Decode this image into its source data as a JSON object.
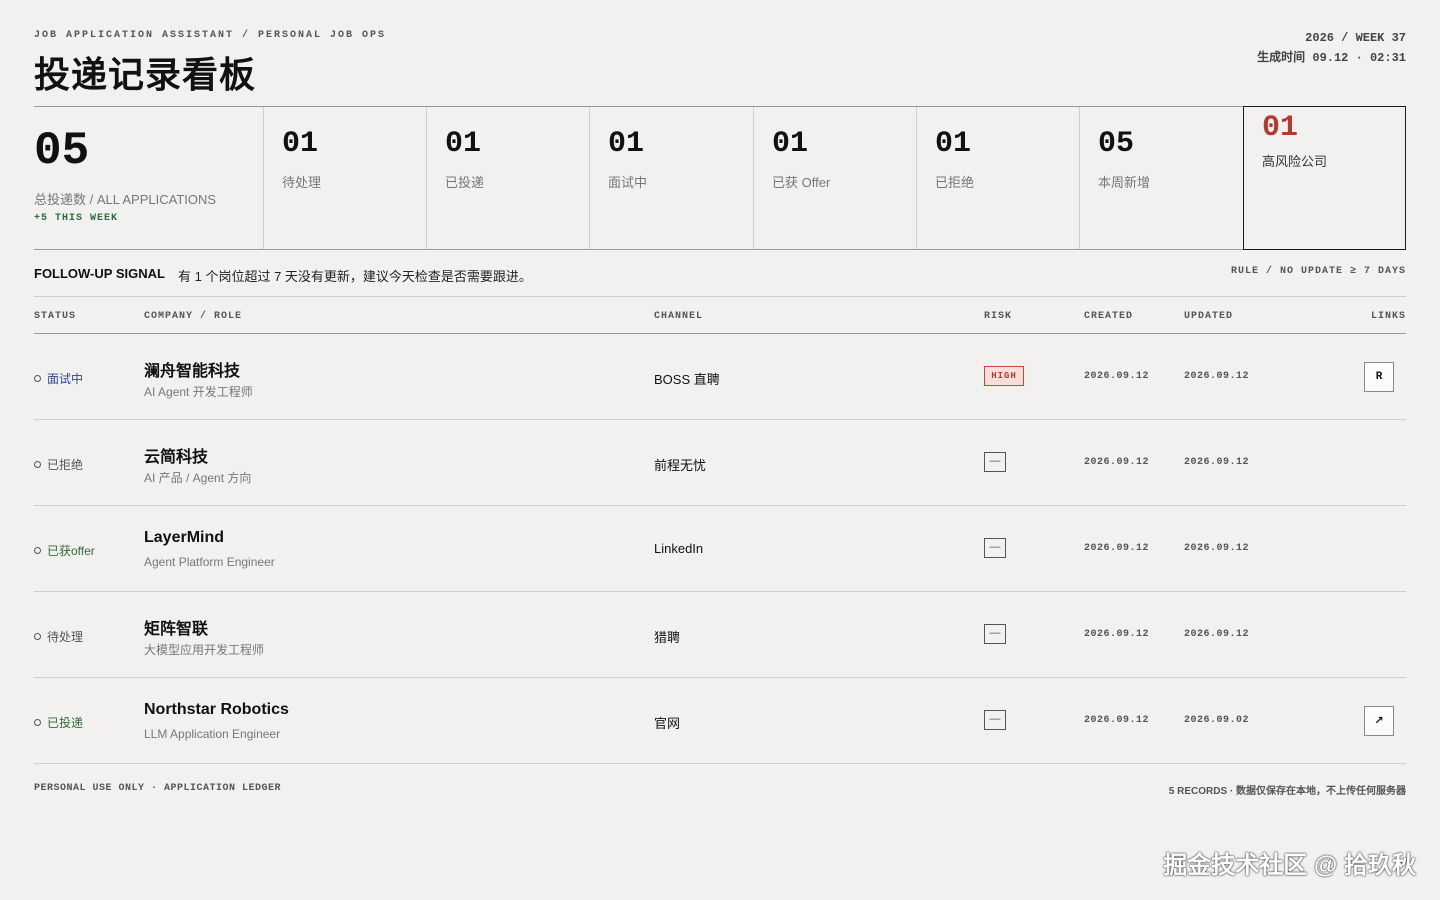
{
  "header": {
    "kicker": "JOB APPLICATION ASSISTANT / PERSONAL JOB OPS",
    "title": "投递记录看板",
    "week": "2026 / WEEK 37",
    "generated": "生成时间 09.12 · 02:31"
  },
  "stats": {
    "total": {
      "value": "05",
      "label": "总投递数 / ALL APPLICATIONS",
      "delta": "+5 THIS WEEK"
    },
    "cards": [
      {
        "value": "01",
        "label": "待处理"
      },
      {
        "value": "01",
        "label": "已投递"
      },
      {
        "value": "01",
        "label": "面试中"
      },
      {
        "value": "01",
        "label": "已获 Offer"
      },
      {
        "value": "01",
        "label": "已拒绝"
      },
      {
        "value": "05",
        "label": "本周新增"
      }
    ],
    "risk": {
      "value": "01",
      "label": "高风险公司"
    }
  },
  "followup": {
    "title": "FOLLOW-UP SIGNAL",
    "message": "有 1 个岗位超过 7 天没有更新，建议今天检查是否需要跟进。",
    "rule": "RULE / NO UPDATE ≥ 7 DAYS"
  },
  "table": {
    "headers": {
      "status": "STATUS",
      "company": "COMPANY / ROLE",
      "channel": "CHANNEL",
      "risk": "RISK",
      "created": "CREATED",
      "updated": "UPDATED",
      "links": "LINKS"
    },
    "rows": [
      {
        "status": "面试中",
        "company": "澜舟智能科技",
        "role": "AI Agent 开发工程师",
        "channel": "BOSS 直聘",
        "risk": "HIGH",
        "created": "2026.09.12",
        "updated": "2026.09.12",
        "link": "R"
      },
      {
        "status": "已拒绝",
        "company": "云简科技",
        "role": "AI 产品 / Agent 方向",
        "channel": "前程无忧",
        "risk": "—",
        "created": "2026.09.12",
        "updated": "2026.09.12",
        "link": ""
      },
      {
        "status": "已获offer",
        "company": "LayerMind",
        "role": "Agent Platform Engineer",
        "channel": "LinkedIn",
        "risk": "—",
        "created": "2026.09.12",
        "updated": "2026.09.12",
        "link": ""
      },
      {
        "status": "待处理",
        "company": "矩阵智联",
        "role": "大模型应用开发工程师",
        "channel": "猎聘",
        "risk": "—",
        "created": "2026.09.12",
        "updated": "2026.09.12",
        "link": ""
      },
      {
        "status": "已投递",
        "company": "Northstar Robotics",
        "role": "LLM Application Engineer",
        "channel": "官网",
        "risk": "—",
        "created": "2026.09.12",
        "updated": "2026.09.02",
        "link": "↗"
      }
    ]
  },
  "footer": {
    "left": "PERSONAL USE ONLY · APPLICATION LEDGER",
    "right": "5 RECORDS · 数据仅保存在本地，不上传任何服务器"
  },
  "watermark": "掘金技术社区 @ 拾玖秋",
  "colors": {
    "background": "#f2f1ef",
    "risk_red": "#b23a2e",
    "positive_green": "#2f6b3e",
    "interview_blue": "#2a4a8a"
  }
}
